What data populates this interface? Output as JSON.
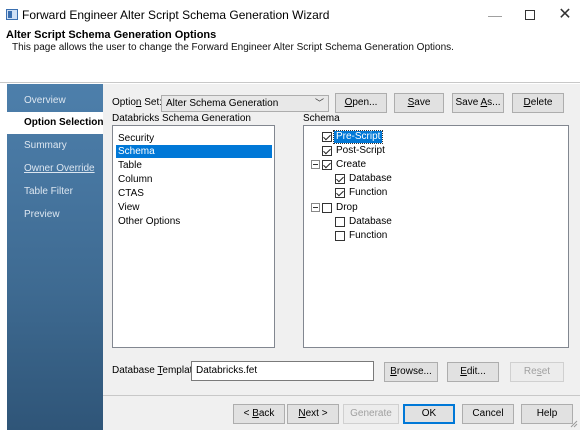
{
  "window": {
    "title": "Forward Engineer Alter Script Schema Generation Wizard",
    "minimize_glyph": "—",
    "close_glyph": "✕"
  },
  "header": {
    "heading": "Alter Script Schema Generation Options",
    "description": "This page allows the user to change the Forward Engineer Alter Script Schema Generation Options."
  },
  "sidebar": {
    "items": [
      {
        "label": "Overview"
      },
      {
        "label": "Option Selection"
      },
      {
        "label": "Summary"
      },
      {
        "label": "Owner Override"
      },
      {
        "label": "Table Filter"
      },
      {
        "label": "Preview"
      }
    ]
  },
  "option_set": {
    "label_pre": "Optio",
    "label_key": "n",
    "label_post": " Set:",
    "value": "Alter Schema Generation",
    "arrow": "﹀",
    "open_pre": "",
    "open_key": "O",
    "open_post": "pen...",
    "save_pre": "",
    "save_key": "S",
    "save_post": "ave",
    "saveas_pre": "Save ",
    "saveas_key": "A",
    "saveas_post": "s...",
    "delete_pre": "",
    "delete_key": "D",
    "delete_post": "elete"
  },
  "left_panel": {
    "header": "Databricks  Schema Generation",
    "items": [
      "Security",
      "Schema",
      "Table",
      "Column",
      "CTAS",
      "View",
      "Other Options"
    ],
    "selected": "Schema"
  },
  "right_panel": {
    "header": "Schema",
    "nodes": [
      {
        "label": "Pre-Script",
        "checked": true
      },
      {
        "label": "Post-Script",
        "checked": true
      },
      {
        "label": "Create",
        "checked": true
      },
      {
        "label": "Database",
        "checked": true
      },
      {
        "label": "Function",
        "checked": true
      },
      {
        "label": "Drop",
        "checked": false
      },
      {
        "label": "Database",
        "checked": false
      },
      {
        "label": "Function",
        "checked": false
      }
    ]
  },
  "template": {
    "label_pre": "Database ",
    "label_key": "T",
    "label_post": "emplate:",
    "value": "Databricks.fet",
    "browse_pre": "",
    "browse_key": "B",
    "browse_post": "rowse...",
    "edit_pre": "",
    "edit_key": "E",
    "edit_post": "dit...",
    "reset_pre": "Re",
    "reset_key": "s",
    "reset_post": "et"
  },
  "footer": {
    "back_pre": "< ",
    "back_key": "B",
    "back_post": "ack",
    "next_pre": "",
    "next_key": "N",
    "next_post": "ext >",
    "generate": "Generate",
    "ok": "OK",
    "cancel": "Cancel",
    "help": "Help"
  },
  "colors": {
    "selection": "#0078d7",
    "sidebar_top": "#4d7fab",
    "sidebar_bottom": "#2f5578"
  }
}
